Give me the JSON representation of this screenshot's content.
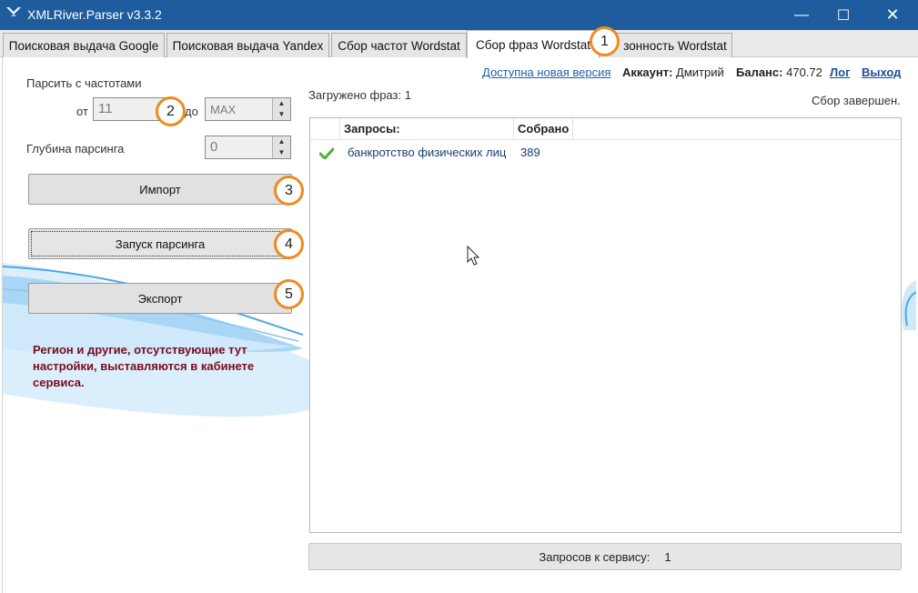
{
  "window": {
    "title": "XMLRiver.Parser v3.3.2",
    "min_glyph": "—",
    "max_glyph": "☐",
    "close_glyph": "✕"
  },
  "tabs": [
    {
      "label": "Поисковая выдача Google",
      "active": false
    },
    {
      "label": "Поисковая выдача Yandex",
      "active": false
    },
    {
      "label": "Сбор частот Wordstat",
      "active": false
    },
    {
      "label": "Сбор фраз Wordstat",
      "active": true
    },
    {
      "label": "зонность Wordstat",
      "active": false
    }
  ],
  "form": {
    "freq_label": "Парсить с частотами",
    "from_label": "от",
    "from_value": "11",
    "to_label": "до",
    "to_value": "MAX",
    "depth_label": "Глубина парсинга",
    "depth_value": "0",
    "spin_up": "▲",
    "spin_down": "▼",
    "import_button": "Импорт",
    "start_button": "Запуск парсинга",
    "export_button": "Экспорт",
    "note": "Регион и другие, отсутствующие тут настройки, выставляются в кабинете сервиса."
  },
  "header": {
    "new_version_link": "Доступна новая версия",
    "account_label": "Аккаунт:",
    "account_value": "Дмитрий",
    "balance_label": "Баланс:",
    "balance_value": "470.72",
    "log_link": "Лог",
    "exit_link": "Выход"
  },
  "status": {
    "loaded": "Загружено фраз: 1",
    "done": "Сбор завершен."
  },
  "grid": {
    "columns": [
      "Запросы:",
      "Собрано"
    ],
    "rows": [
      {
        "status_icon": "check-icon",
        "query": "банкротство физических лиц",
        "collected": "389"
      }
    ]
  },
  "footer": {
    "requests_label": "Запросов к сервису:",
    "requests_value": "1"
  },
  "badges": [
    "1",
    "2",
    "3",
    "4",
    "5"
  ],
  "colors": {
    "titlebar": "#1f5c9e",
    "badge_border": "#ec8c1f",
    "note_text": "#7a0c1d",
    "link": "#2361a8",
    "check": "#4caf3d"
  }
}
